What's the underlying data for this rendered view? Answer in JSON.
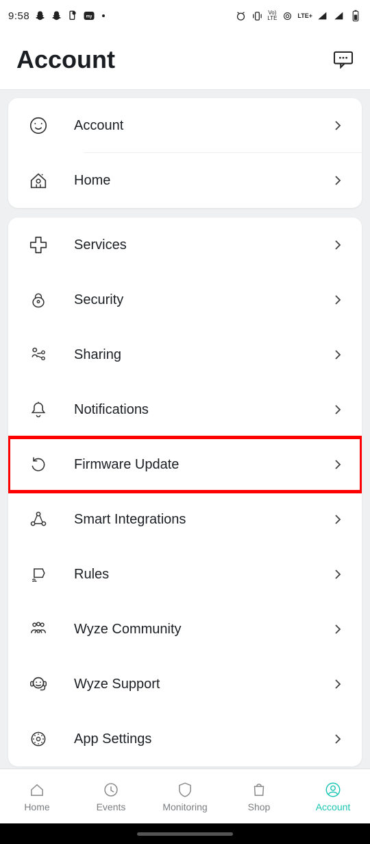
{
  "status": {
    "time": "9:58",
    "net_label": "LTE+",
    "sub_label": "Vo)\nLTE"
  },
  "header": {
    "title": "Account"
  },
  "group1": {
    "items": [
      {
        "label": "Account"
      },
      {
        "label": "Home"
      }
    ]
  },
  "group2": {
    "items": [
      {
        "label": "Services"
      },
      {
        "label": "Security"
      },
      {
        "label": "Sharing"
      },
      {
        "label": "Notifications"
      },
      {
        "label": "Firmware Update",
        "highlight": true
      },
      {
        "label": "Smart Integrations"
      },
      {
        "label": "Rules"
      },
      {
        "label": "Wyze Community"
      },
      {
        "label": "Wyze Support"
      },
      {
        "label": "App Settings"
      }
    ]
  },
  "nav": {
    "items": [
      {
        "label": "Home"
      },
      {
        "label": "Events"
      },
      {
        "label": "Monitoring"
      },
      {
        "label": "Shop"
      },
      {
        "label": "Account",
        "active": true
      }
    ]
  }
}
